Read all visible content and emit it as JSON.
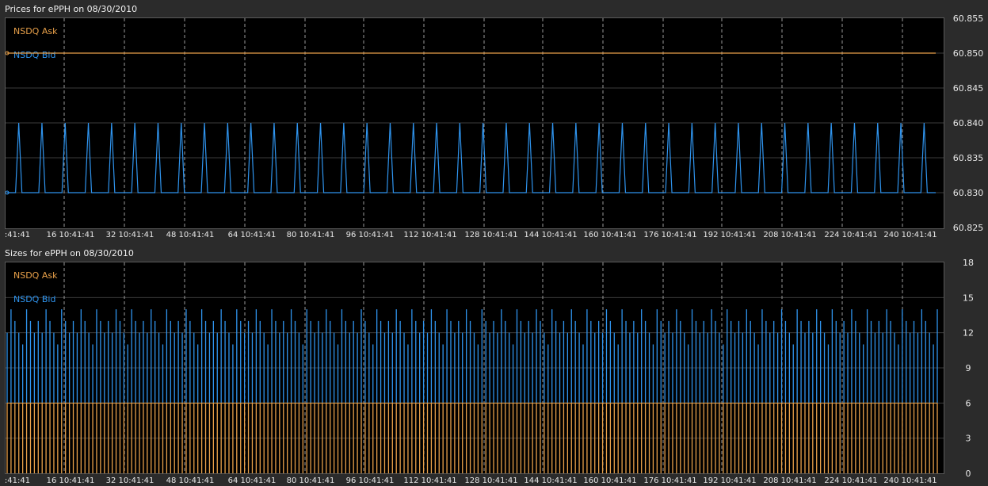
{
  "colors": {
    "ask": "#e9a14a",
    "bid": "#2f94ee",
    "grid_h": "#3c3c3c",
    "grid_v": "#9a9a9a",
    "background": "#000000",
    "chrome": "#2b2b2b"
  },
  "chart_data": [
    {
      "type": "line",
      "title": "Prices for  ePPH  on  08/30/2010",
      "ylim": [
        60.825,
        60.855
      ],
      "y_ticks": [
        "60.855",
        "60.850",
        "60.845",
        "60.840",
        "60.835",
        "60.830",
        "60.825"
      ],
      "x_tick_labels": [
        ":41:41",
        "16 10:41:41",
        "32 10:41:41",
        "48 10:41:41",
        "64 10:41:41",
        "80 10:41:41",
        "96 10:41:41",
        "112 10:41:41",
        "128 10:41:41",
        "144 10:41:41",
        "160 10:41:41",
        "176 10:41:41",
        "192 10:41:41",
        "208 10:41:41",
        "224 10:41:41",
        "240 10:41:41"
      ],
      "grid": true,
      "legend": "top-left",
      "series": [
        {
          "name": "NSDQ Ask",
          "values": [
            60.85,
            60.85
          ]
        },
        {
          "name": "NSDQ Bid",
          "pattern": {
            "low": 60.83,
            "high": 60.84,
            "peaks": 40
          }
        }
      ]
    },
    {
      "type": "bar",
      "title": "Sizes for  ePPH  on  08/30/2010",
      "ylim": [
        0,
        18
      ],
      "y_ticks": [
        "18",
        "15",
        "12",
        "9",
        "6",
        "3",
        "0"
      ],
      "x_tick_labels": [
        ":41:41",
        "16 10:41:41",
        "32 10:41:41",
        "48 10:41:41",
        "64 10:41:41",
        "80 10:41:41",
        "96 10:41:41",
        "112 10:41:41",
        "128 10:41:41",
        "144 10:41:41",
        "160 10:41:41",
        "176 10:41:41",
        "192 10:41:41",
        "208 10:41:41",
        "224 10:41:41",
        "240 10:41:41"
      ],
      "grid": true,
      "legend": "top-left",
      "series": [
        {
          "name": "NSDQ Ask",
          "values": [
            6
          ]
        },
        {
          "name": "NSDQ Bid",
          "values": [
            12,
            14,
            13,
            12,
            11,
            14,
            13,
            12,
            13
          ]
        }
      ]
    }
  ]
}
